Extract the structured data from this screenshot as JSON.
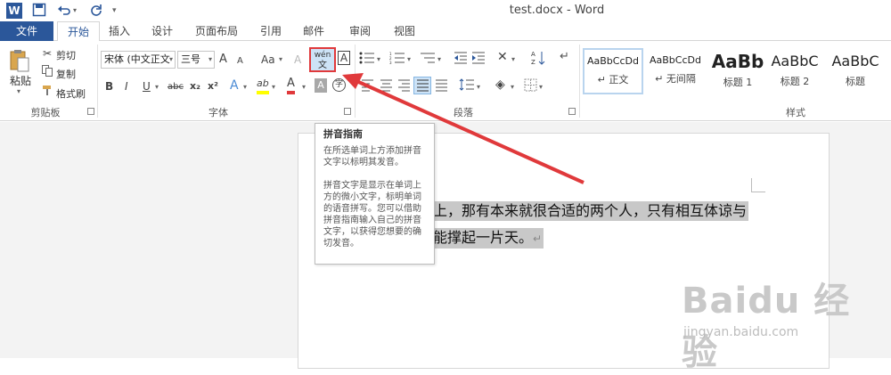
{
  "window": {
    "title": "test.docx - Word"
  },
  "qat": {
    "app_icon": "W",
    "save_icon": "save-icon",
    "undo_icon": "undo-icon",
    "redo_icon": "redo-icon",
    "customize_icon": "customize-icon"
  },
  "tabs": {
    "file": "文件",
    "items": [
      "开始",
      "插入",
      "设计",
      "页面布局",
      "引用",
      "邮件",
      "审阅",
      "视图"
    ],
    "active": "开始"
  },
  "clipboard": {
    "paste": "粘贴",
    "cut": "剪切",
    "copy": "复制",
    "format_painter": "格式刷",
    "label": "剪贴板"
  },
  "font": {
    "font_name": "宋体 (中文正文",
    "font_size": "三号",
    "grow": "A",
    "shrink": "A",
    "case": "Aa",
    "clear": "A",
    "pinyin_top": "wén",
    "pinyin_bottom": "文",
    "border_char": "A",
    "bold": "B",
    "italic": "I",
    "underline": "U",
    "strike": "abc",
    "subscript": "x₂",
    "superscript": "x²",
    "text_effect": "A",
    "highlight": "ab",
    "font_color": "A",
    "char_shading": "A",
    "enclose": "字",
    "label": "字体"
  },
  "paragraph": {
    "label": "段落"
  },
  "styles": {
    "label": "样式",
    "items": [
      {
        "sample": "AaBbCcDd",
        "name": "↵ 正文"
      },
      {
        "sample": "AaBbCcDd",
        "name": "↵ 无间隔"
      },
      {
        "sample": "AaBb",
        "name": "标题 1"
      },
      {
        "sample": "AaBbC",
        "name": "标题 2"
      },
      {
        "sample": "AaBbC",
        "name": "标题"
      }
    ]
  },
  "document": {
    "line1": "上，那有本来就很合适的两个人，只有相互体谅与",
    "line2": "能撑起一片天。",
    "para_mark": "↵"
  },
  "tooltip": {
    "title": "拼音指南",
    "p1": "在所选单词上方添加拼音文字以标明其发音。",
    "p2": "拼音文字是显示在单词上方的微小文字，标明单词的语音拼写。您可以借助拼音指南输入自己的拼音文字，以获得您想要的确切发音。"
  },
  "watermark": {
    "main": "Baidu 经验",
    "sub": "jingyan.baidu.com"
  },
  "colors": {
    "word_blue": "#2b579a",
    "highlight_red": "#e0393b",
    "selection_gray": "#c8c8c8"
  }
}
